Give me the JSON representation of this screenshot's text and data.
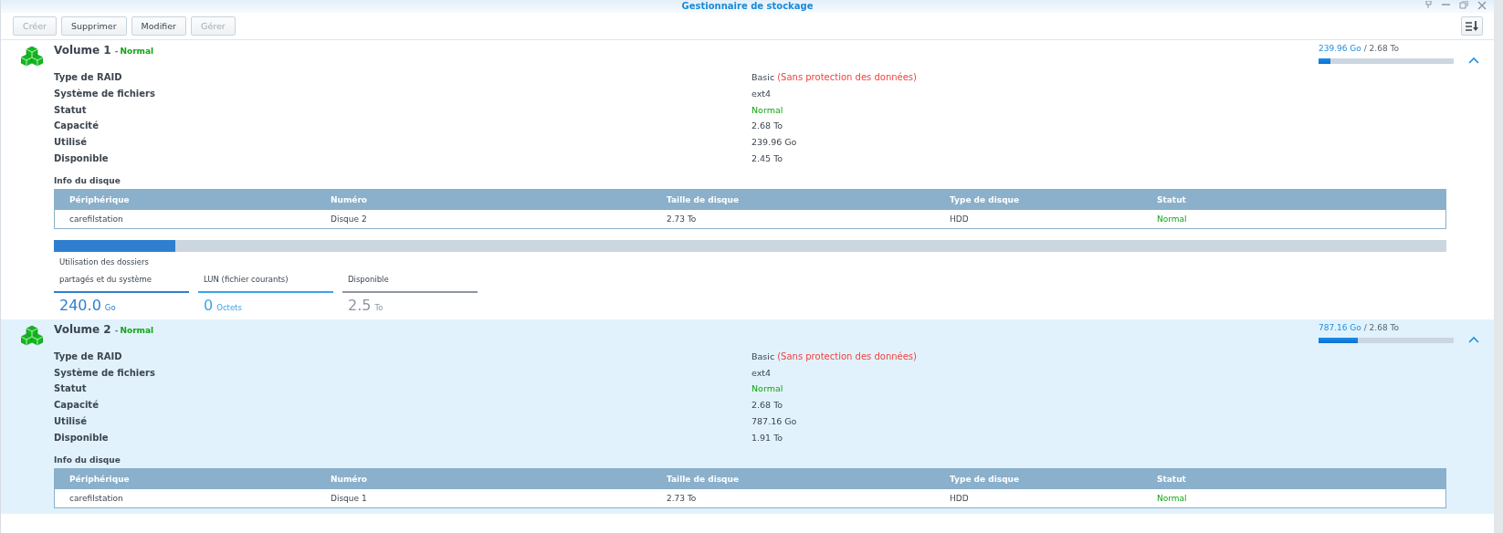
{
  "window": {
    "title": "Gestionnaire de stockage"
  },
  "toolbar": {
    "buttons": [
      {
        "label": "Créer",
        "disabled": true
      },
      {
        "label": "Supprimer",
        "disabled": false
      },
      {
        "label": "Modifier",
        "disabled": false
      },
      {
        "label": "Gérer",
        "disabled": true
      }
    ]
  },
  "volumes": [
    {
      "name": "Volume 1",
      "separator": "-",
      "status": "Normal",
      "selected": false,
      "expanded": true,
      "used": "239.96 Go",
      "total": "/ 2.68 To",
      "level": 0.09,
      "details": [
        {
          "label": "Type de RAID",
          "value": "Basic",
          "note": "(Sans protection des données)",
          "kind": "plain"
        },
        {
          "label": "Système de fichiers",
          "value": "ext4",
          "kind": "plain"
        },
        {
          "label": "Statut",
          "value": "Normal",
          "kind": "status"
        },
        {
          "label": "Capacité",
          "value": "2.68 To",
          "kind": "plain"
        },
        {
          "label": "Utilisé",
          "value": "239.96 Go",
          "kind": "plain"
        },
        {
          "label": "Disponible",
          "value": "2.45 To",
          "kind": "plain"
        }
      ],
      "disk_info": {
        "title": "Info du disque",
        "columns": [
          "Périphérique",
          "Numéro",
          "Taille de disque",
          "Type de disque",
          "Statut"
        ],
        "rows": [
          {
            "cells": [
              {
                "text": "carefilstation",
                "kind": "plain"
              },
              {
                "text": "Disque 2",
                "kind": "plain"
              },
              {
                "text": "2.73 To",
                "kind": "plain"
              },
              {
                "text": "HDD",
                "kind": "plain"
              },
              {
                "text": "Normal",
                "kind": "status"
              }
            ]
          }
        ]
      },
      "usage": {
        "level": 0.087,
        "segments": [
          {
            "label": "Utilisation des dossiers partagés et du système",
            "value": "240.0",
            "unit": "Go",
            "color": "#2f7fce"
          },
          {
            "label": "LUN (fichier courants)",
            "value": "0",
            "unit": "Octets",
            "color": "#3ba3ea"
          },
          {
            "label": "Disponible",
            "value": "2.5",
            "unit": "To",
            "color": "#8c96a1"
          }
        ]
      }
    },
    {
      "name": "Volume 2",
      "separator": "-",
      "status": "Normal",
      "selected": true,
      "expanded": true,
      "used": "787.16 Go",
      "total": "/ 2.68 To",
      "level": 0.29,
      "details": [
        {
          "label": "Type de RAID",
          "value": "Basic",
          "note": "(Sans protection des données)",
          "kind": "plain"
        },
        {
          "label": "Système de fichiers",
          "value": "ext4",
          "kind": "plain"
        },
        {
          "label": "Statut",
          "value": "Normal",
          "kind": "status"
        },
        {
          "label": "Capacité",
          "value": "2.68 To",
          "kind": "plain"
        },
        {
          "label": "Utilisé",
          "value": "787.16 Go",
          "kind": "plain"
        },
        {
          "label": "Disponible",
          "value": "1.91 To",
          "kind": "plain"
        }
      ],
      "disk_info": {
        "title": "Info du disque",
        "columns": [
          "Périphérique",
          "Numéro",
          "Taille de disque",
          "Type de disque",
          "Statut"
        ],
        "rows": [
          {
            "cells": [
              {
                "text": "carefilstation",
                "kind": "plain"
              },
              {
                "text": "Disque 1",
                "kind": "plain"
              },
              {
                "text": "2.73 To",
                "kind": "plain"
              },
              {
                "text": "HDD",
                "kind": "plain"
              },
              {
                "text": "Normal",
                "kind": "status"
              }
            ]
          }
        ]
      }
    }
  ]
}
